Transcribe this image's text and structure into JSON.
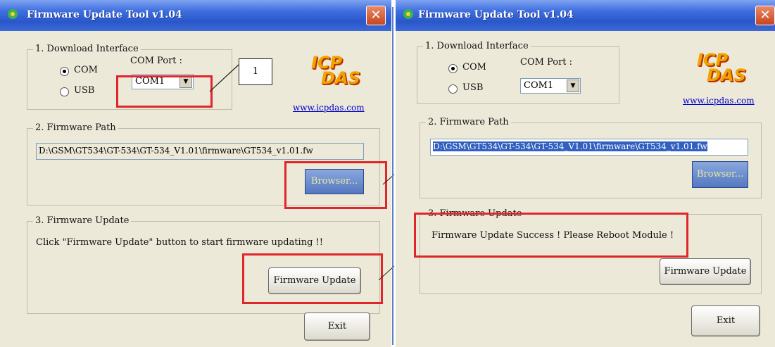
{
  "window_left": {
    "title": "Firmware Update Tool v1.04",
    "close_label": "✕",
    "download_interface": {
      "group_label": "1. Download Interface",
      "radio_com": "COM",
      "radio_usb": "USB",
      "com_port_label": "COM Port :",
      "com_port_value": "COM1",
      "selected": "COM"
    },
    "logo_text_top": "ICP",
    "logo_text_bottom": "DAS",
    "website": "www.icpdas.com",
    "firmware_path": {
      "group_label": "2. Firmware Path",
      "path_value": "D:\\GSM\\GT534\\GT-534\\GT-534_V1.01\\firmware\\GT534_v1.01.fw",
      "browse_label": "Browser..."
    },
    "firmware_update": {
      "group_label": "3. Firmware Update",
      "message": "Click  \"Firmware Update\" button to start firmware updating !!",
      "update_label": "Firmware Update"
    },
    "exit_label": "Exit",
    "callout_number": "1"
  },
  "window_right": {
    "title": "Firmware Update Tool v1.04",
    "close_label": "✕",
    "download_interface": {
      "group_label": "1. Download Interface",
      "radio_com": "COM",
      "radio_usb": "USB",
      "com_port_label": "COM Port :",
      "com_port_value": "COM1",
      "selected": "COM"
    },
    "logo_text_top": "ICP",
    "logo_text_bottom": "DAS",
    "website": "www.icpdas.com",
    "firmware_path": {
      "group_label": "2. Firmware Path",
      "path_value": "D:\\GSM\\GT534\\GT-534\\GT-534_V1.01\\firmware\\GT534_v1.01.fw",
      "browse_label": "Browser..."
    },
    "firmware_update": {
      "group_label": "3. Firmware Update",
      "message": "Firmware Update Success !  Please Reboot Module !",
      "update_label": "Firmware Update"
    },
    "exit_label": "Exit"
  },
  "colors": {
    "annotation_red": "#e0262a",
    "titlebar_blue": "#2a57c9",
    "dialog_bg": "#ece9d8"
  }
}
